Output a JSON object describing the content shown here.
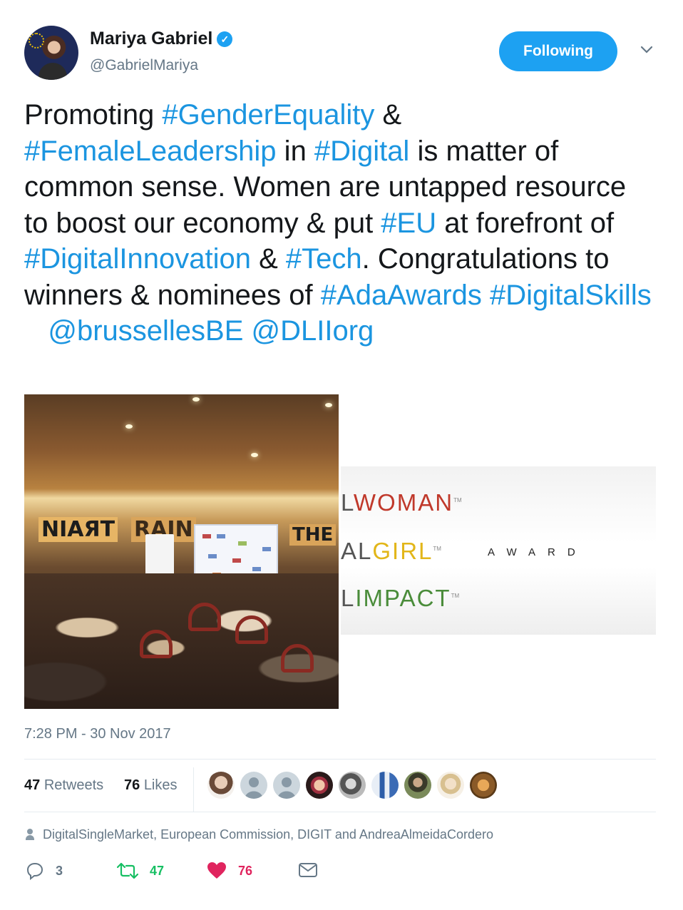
{
  "tweet": {
    "author": {
      "name": "Mariya Gabriel",
      "handle": "@GabrielMariya",
      "verified_glyph": "✓"
    },
    "follow_label": "Following",
    "caret_glyph": "⌄",
    "text_segments": [
      {
        "t": "Promoting ",
        "link": false
      },
      {
        "t": "#GenderEquality",
        "link": true
      },
      {
        "t": " &",
        "link": false
      },
      {
        "t": "#FemaleLeadership",
        "link": true
      },
      {
        "t": " in ",
        "link": false
      },
      {
        "t": "#Digital",
        "link": true
      },
      {
        "t": " is matter of common sense. Women are untapped resource to boost our economy & put ",
        "link": false
      },
      {
        "t": "#EU",
        "link": true
      },
      {
        "t": " at forefront of ",
        "link": false
      },
      {
        "t": "#DigitalInnovation",
        "link": true
      },
      {
        "t": " & ",
        "link": false
      },
      {
        "t": "#Tech",
        "link": true
      },
      {
        "t": ". Congratulations to winners & nominees of ",
        "link": false
      },
      {
        "t": "#AdaAwards",
        "link": true
      },
      {
        "t": " ",
        "link": false
      },
      {
        "t": "#DigitalSkills",
        "link": true
      },
      {
        "t": "   ",
        "link": false
      },
      {
        "t": "@brussellesBE",
        "link": true
      },
      {
        "t": " ",
        "link": false
      },
      {
        "t": "@DLIIorg",
        "link": true
      }
    ],
    "media": {
      "photo1": {
        "signs": [
          "NIAЯT",
          "RAIN",
          "THE"
        ]
      },
      "photo2": {
        "lines": [
          {
            "prefix": "L",
            "word": "WOMAN",
            "tm": "TM",
            "color": "#c0392b"
          },
          {
            "prefix": "AL",
            "word": "GIRL",
            "tm": "TM",
            "color": "#e2b619"
          },
          {
            "prefix": "L",
            "word": "IMPACT",
            "tm": "TM",
            "color": "#4a8c3a"
          }
        ],
        "award": "AWARD"
      }
    },
    "timestamp": "7:28 PM - 30 Nov 2017",
    "stats": {
      "retweets_count": "47",
      "retweets_label": "Retweets",
      "likes_count": "76",
      "likes_label": "Likes"
    },
    "likers_faces": 9,
    "context": "DigitalSingleMarket, European Commission, DIGIT and AndreaAlmeidaCordero",
    "actions": {
      "reply_count": "3",
      "retweet_count": "47",
      "like_count": "76"
    },
    "colors": {
      "link": "#1b95e0",
      "retweet_green": "#17bf63",
      "like_red": "#e0245e",
      "muted": "#657786"
    }
  }
}
